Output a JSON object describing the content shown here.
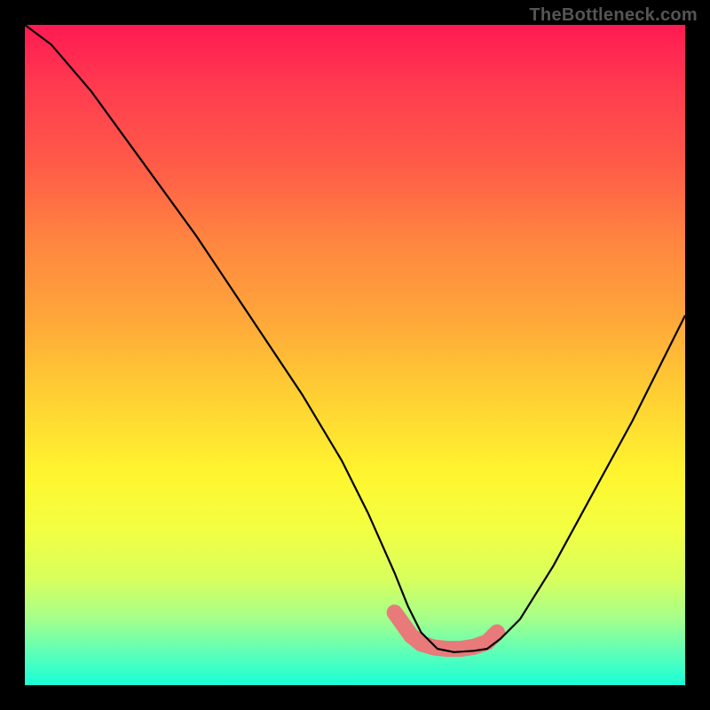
{
  "watermark": "TheBottleneck.com",
  "colors": {
    "page_bg": "#000000",
    "curve": "#000000",
    "band": "#e87a7a"
  },
  "chart_data": {
    "type": "line",
    "title": "",
    "xlabel": "",
    "ylabel": "",
    "xlim": [
      0,
      100
    ],
    "ylim": [
      0,
      100
    ],
    "grid": false,
    "legend": false,
    "series": [
      {
        "name": "bottleneck-curve",
        "x": [
          0,
          4,
          10,
          18,
          26,
          34,
          42,
          48,
          52,
          56,
          58,
          60,
          62.5,
          65,
          68,
          70,
          72,
          75,
          80,
          86,
          92,
          100
        ],
        "y": [
          100,
          97,
          90,
          79,
          68,
          56,
          44,
          34,
          26,
          17,
          12,
          8,
          5.5,
          5,
          5.2,
          5.5,
          7,
          10,
          18,
          29,
          40,
          56
        ]
      }
    ],
    "highlight_band": {
      "name": "optimal-range",
      "x": [
        56,
        58.5,
        60,
        62,
        64,
        66,
        68,
        70,
        71.5
      ],
      "y": [
        11,
        7.5,
        6.3,
        5.7,
        5.5,
        5.5,
        5.8,
        6.5,
        8
      ]
    }
  }
}
